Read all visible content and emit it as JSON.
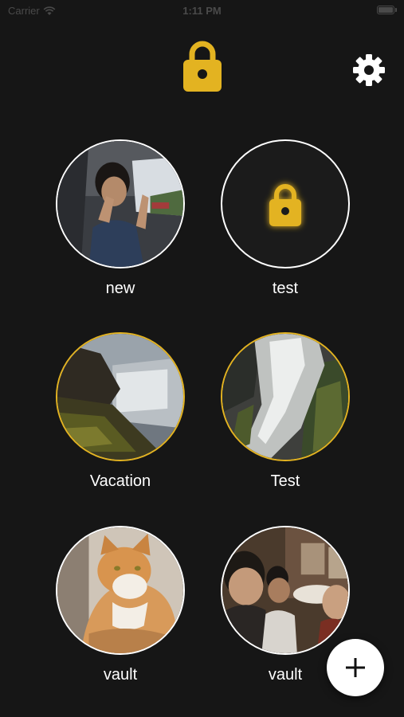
{
  "status_bar": {
    "carrier": "Carrier",
    "time": "1:11 PM"
  },
  "header": {
    "logo_icon": "lock-icon",
    "settings_icon": "gear-icon"
  },
  "colors": {
    "background": "#161616",
    "accent_gold": "#e3b321",
    "ring_white": "#ffffff"
  },
  "vaults": [
    {
      "name": "new",
      "ring": "white",
      "thumbnail": "photo-person-in-car"
    },
    {
      "name": "test",
      "ring": "white",
      "thumbnail": "locked-icon"
    },
    {
      "name": "Vacation",
      "ring": "gold",
      "thumbnail": "photo-waterfall-dusk"
    },
    {
      "name": "Test",
      "ring": "gold",
      "thumbnail": "photo-waterfall-closeup"
    },
    {
      "name": "vault",
      "ring": "white",
      "thumbnail": "photo-orange-cat"
    },
    {
      "name": "vault",
      "ring": "white",
      "thumbnail": "photo-group-selfie"
    }
  ],
  "fab": {
    "icon": "plus-icon"
  }
}
